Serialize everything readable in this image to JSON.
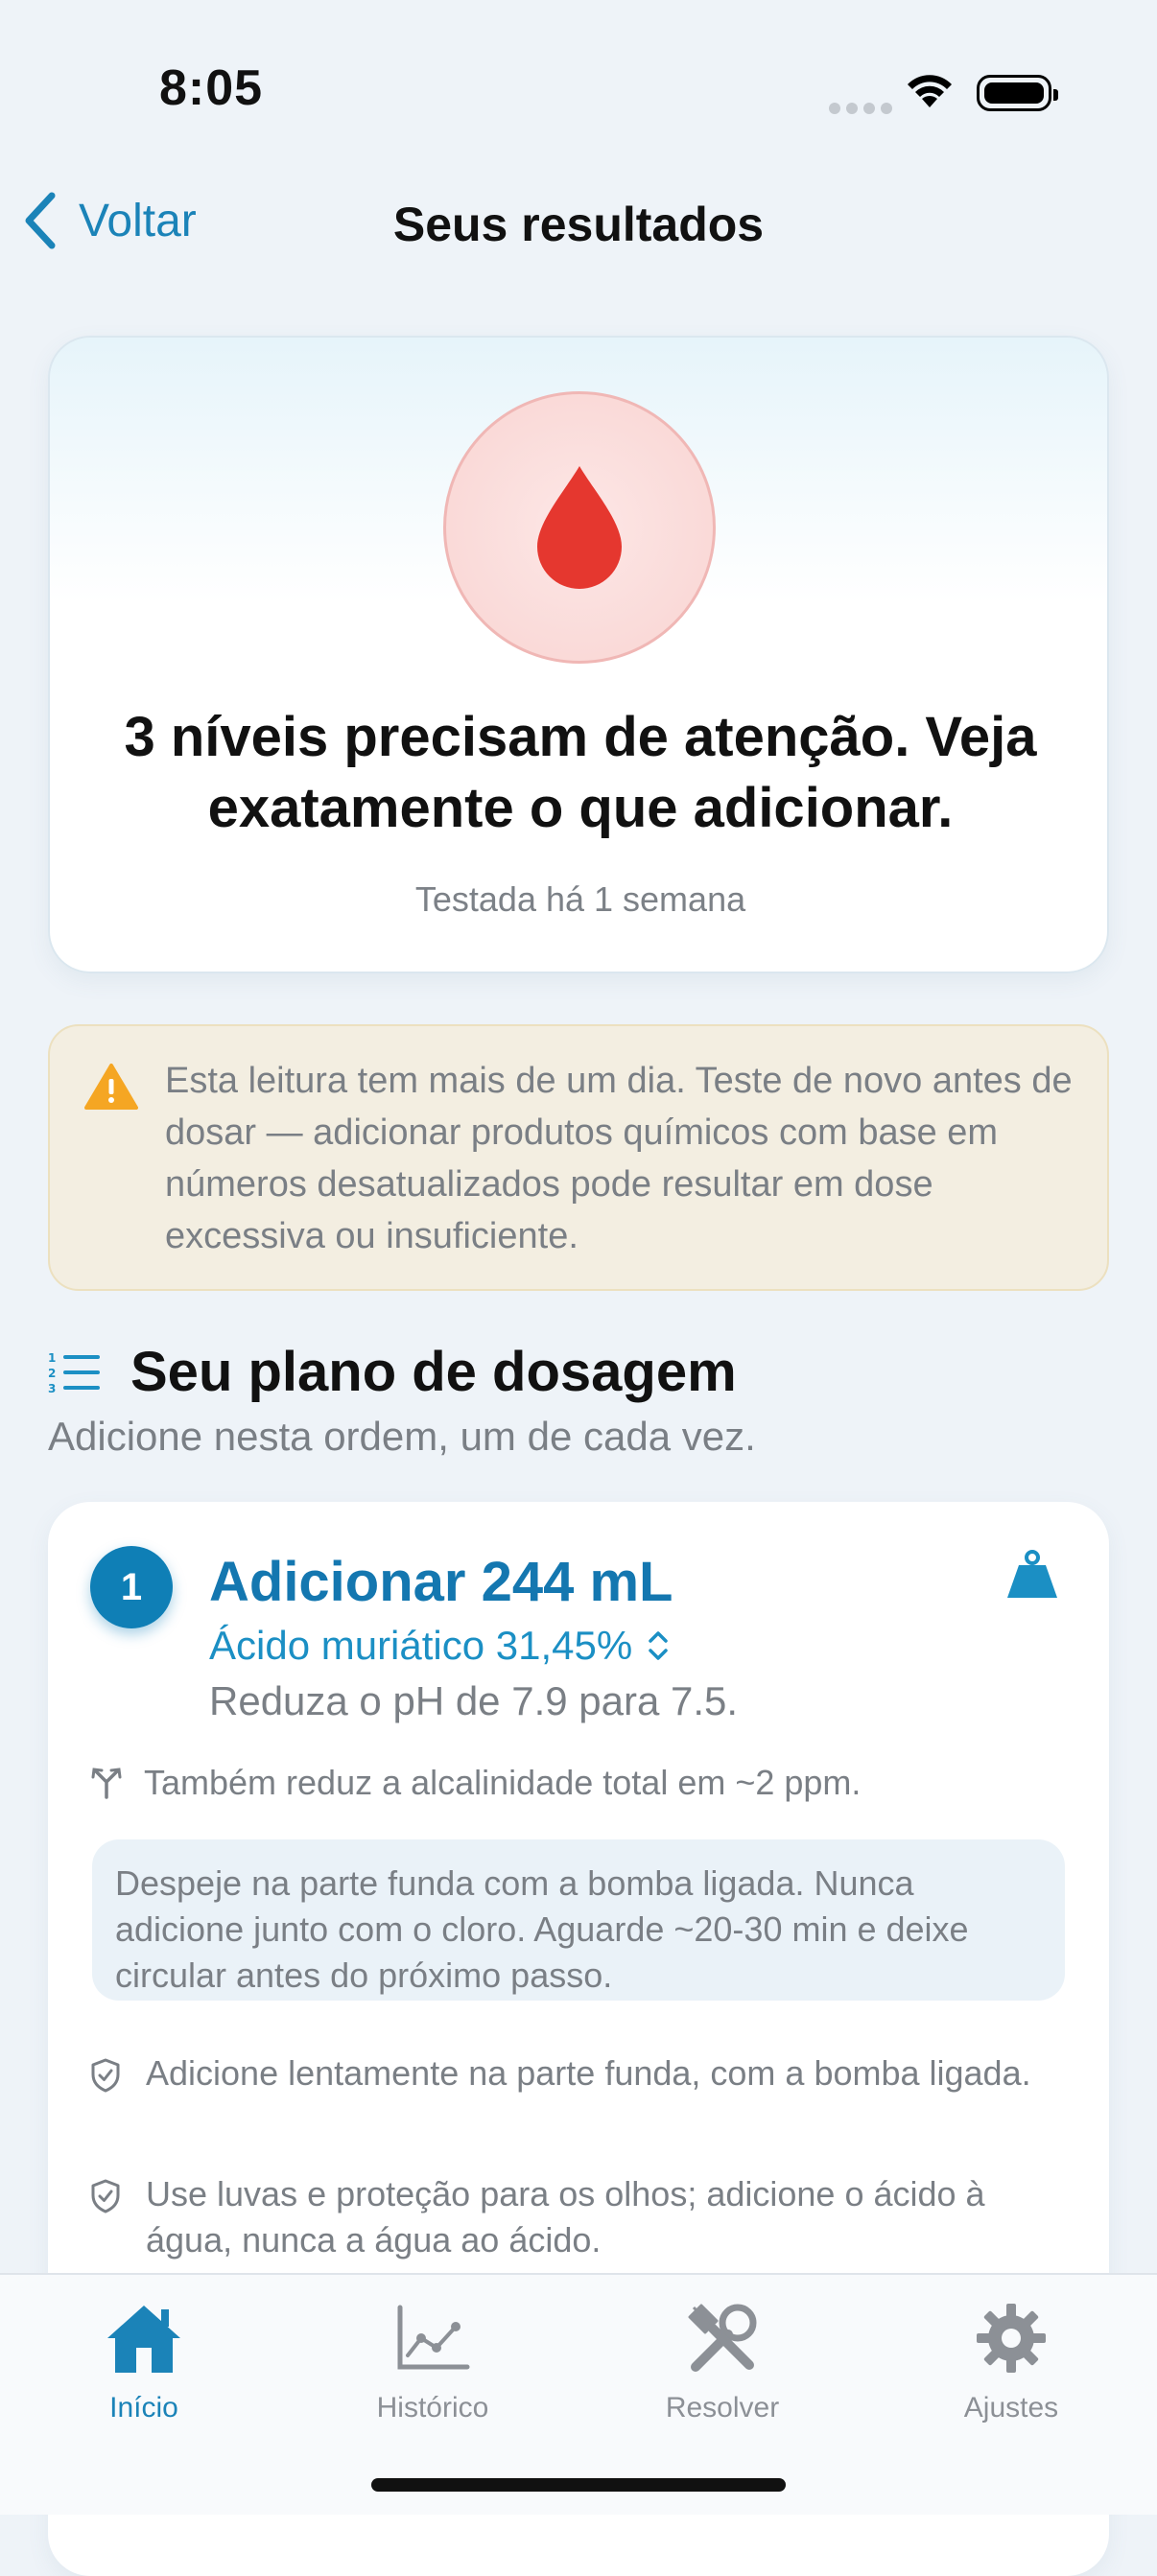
{
  "status_bar": {
    "time": "8:05"
  },
  "nav": {
    "back_label": "Voltar",
    "title": "Seus resultados"
  },
  "summary": {
    "title": "3 níveis precisam de atenção. Veja exatamente o que adicionar.",
    "tested": "Testada há 1 semana",
    "accent_color": "#e5372f"
  },
  "warning": {
    "text": "Esta leitura tem mais de um dia. Teste de novo antes de dosar — adicionar produtos químicos com base em números desatualizados pode resultar em dose excessiva ou insuficiente."
  },
  "plan": {
    "title": "Seu plano de dosagem",
    "subtitle": "Adicione nesta ordem, um de cada vez."
  },
  "step1": {
    "number": "1",
    "title": "Adicionar 244 mL",
    "chemical": "Ácido muriático 31,45%",
    "reduce": "Reduza o pH de 7.9 para 7.5.",
    "side_effect": "Também reduz a alcalinidade total em ~2 ppm.",
    "note": "Despeje na parte funda com a bomba ligada. Nunca adicione junto com o cloro. Aguarde ~20-30 min e deixe circular antes do próximo passo.",
    "tips": [
      "Adicione lentamente na parte funda, com a bomba ligada.",
      "Use luvas e proteção para os olhos; adicione o ácido à água, nunca a água ao ácido."
    ]
  },
  "tabs": [
    {
      "label": "Início",
      "icon": "house-icon",
      "active": true
    },
    {
      "label": "Histórico",
      "icon": "chart-icon",
      "active": false
    },
    {
      "label": "Resolver",
      "icon": "tools-icon",
      "active": false
    },
    {
      "label": "Ajustes",
      "icon": "gear-icon",
      "active": false
    }
  ],
  "colors": {
    "accent": "#1b83b8",
    "step_badge": "#0f7fb6",
    "warning_bg": "#f3eee1",
    "warning_icon": "#f5a623"
  }
}
